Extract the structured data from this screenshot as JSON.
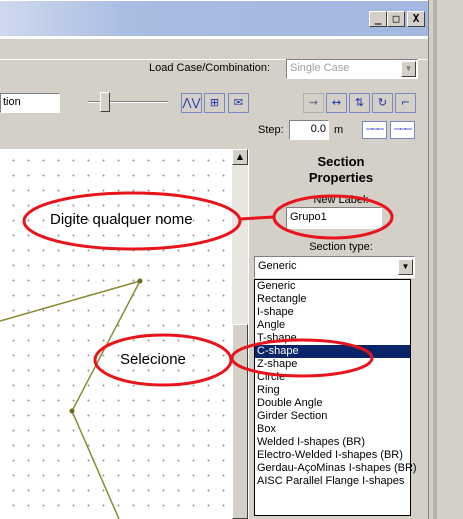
{
  "window": {
    "minimize": "_",
    "maximize": "□",
    "close": "X"
  },
  "toolbar": {
    "load_case_label": "Load Case/Combination:",
    "load_case_value": "Single Case",
    "view_field_value": "tion",
    "step_label": "Step:",
    "step_value": "0.0",
    "step_unit": "m"
  },
  "section_panel": {
    "title_line1": "Section",
    "title_line2": "Properties",
    "new_label_caption": "New Label:",
    "new_label_value": "Grupo1",
    "section_type_caption": "Section type:",
    "section_type_value": "Generic",
    "options": [
      "Generic",
      "Rectangle",
      "I-shape",
      "Angle",
      "T-shape",
      "C-shape",
      "Z-shape",
      "Circle",
      "Ring",
      "Double Angle",
      "Girder Section",
      "Box",
      "Welded I-shapes (BR)",
      "Electro-Welded I-shapes (BR)",
      "Gerdau-AçoMinas I-shapes (BR)",
      "AISC Parallel Flange I-shapes"
    ],
    "selected_option": "C-shape"
  },
  "annotations": {
    "callout1": "Digite qualquer nome",
    "callout2": "Selecione"
  },
  "colors": {
    "annotation_red": "#e8141c",
    "selection_blue": "#0a246a",
    "window_gray": "#d4d0c8",
    "model_lines": "#8a8a30"
  }
}
